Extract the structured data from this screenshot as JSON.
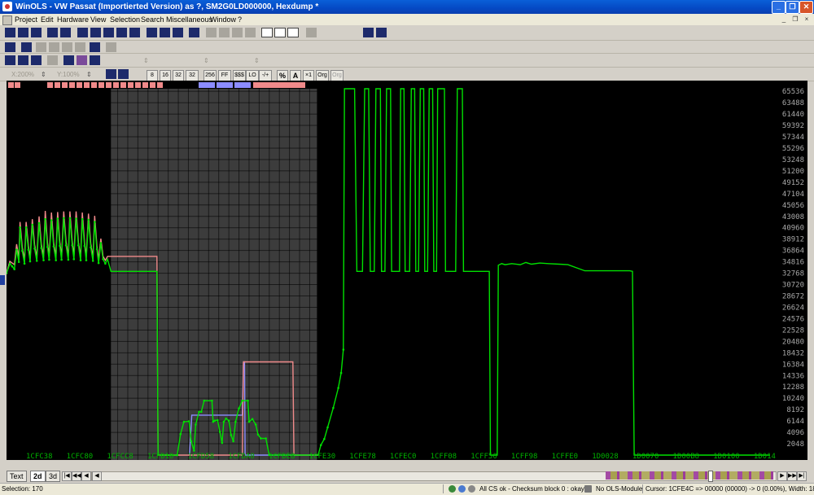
{
  "window": {
    "title": "WinOLS - VW Passat (Importierted Version) as ?, SM2G0LD000000, Hexdump *",
    "controls": [
      "_",
      "❐",
      "✕"
    ]
  },
  "menu": {
    "items": [
      "Project",
      "Edit",
      "Hardware",
      "View",
      "Selection",
      "Search",
      "Miscellaneous",
      "Window",
      "?"
    ],
    "mdi_controls": [
      "_",
      "❐",
      "×"
    ]
  },
  "toolbar3": {
    "zoom_x": "X:200%",
    "zoom_y": "Y:100%",
    "labels": [
      "8",
      "16",
      "32",
      "32 FL",
      "256",
      "FF",
      "$$$",
      "LO HI",
      "-/+",
      "%",
      "A",
      "×1",
      "Org",
      "Org"
    ]
  },
  "colors": {
    "chart_bg": "#000000",
    "primary_line": "#00e000",
    "secondary_line": "#f08a8a",
    "tertiary_line": "#8c8cff",
    "selection_bg": "#3c3c3c",
    "grid": "#141414"
  },
  "chart_data": {
    "type": "line",
    "title": "",
    "xlabel": "",
    "ylabel": "",
    "ylim": [
      0,
      66000
    ],
    "y_ticks": [
      0,
      2048,
      4096,
      6144,
      8192,
      10240,
      12288,
      14336,
      16384,
      18432,
      20480,
      22528,
      24576,
      26624,
      28672,
      30720,
      32768,
      34816,
      36864,
      38912,
      40960,
      43008,
      45056,
      47104,
      49152,
      51200,
      53248,
      55296,
      57344,
      59392,
      61440,
      63488,
      65536
    ],
    "x_ticks": [
      "1CFC38",
      "1CFC80",
      "1CFCC8",
      "1CFD10",
      "1CFD58",
      "1CFDA0",
      "1CFDE8",
      "1CFE30",
      "1CFE78",
      "1CFEC0",
      "1CFF08",
      "1CFF50",
      "1CFF98",
      "1CFFE0",
      "1D0028",
      "1D0070",
      "1D00B8",
      "1D0100",
      "1D0148"
    ],
    "x_tick_labels": [
      "1CFC38",
      "1CFC80",
      "1CFCC8",
      "1CFD10",
      "1CFD58",
      "1CFDA0",
      "1CFDE8",
      "1CFE30",
      "1CFE78",
      "1CFEC0",
      "1CFF08",
      "1CFF50",
      "1CFF98",
      "1CFFE0",
      "1D0028",
      "1D0070",
      "1D00B8",
      "1D0100",
      "1D014"
    ],
    "x_tick_offsets": [
      0,
      72,
      144,
      216,
      288,
      360,
      432,
      504,
      576,
      648,
      720,
      792,
      864,
      936,
      1008,
      1080,
      1152,
      1224,
      1296
    ],
    "x_max": 1360,
    "selection_x": [
      186,
      553
    ],
    "series": [
      {
        "role": "primary",
        "points": [
          [
            0,
            32768
          ],
          [
            6,
            34500
          ],
          [
            10,
            34000
          ],
          [
            14,
            33500
          ],
          [
            18,
            37000
          ],
          [
            22,
            34800
          ],
          [
            24,
            41000
          ],
          [
            28,
            36800
          ],
          [
            32,
            34500
          ],
          [
            35,
            41000
          ],
          [
            39,
            37000
          ],
          [
            42,
            34900
          ],
          [
            46,
            41500
          ],
          [
            50,
            37200
          ],
          [
            54,
            35000
          ],
          [
            58,
            41800
          ],
          [
            62,
            37300
          ],
          [
            66,
            35100
          ],
          [
            69,
            42500
          ],
          [
            73,
            37500
          ],
          [
            76,
            35200
          ],
          [
            80,
            42300
          ],
          [
            84,
            37600
          ],
          [
            88,
            35100
          ],
          [
            91,
            42600
          ],
          [
            95,
            37700
          ],
          [
            98,
            35200
          ],
          [
            102,
            42700
          ],
          [
            106,
            37800
          ],
          [
            110,
            35200
          ],
          [
            113,
            42700
          ],
          [
            117,
            37800
          ],
          [
            120,
            35300
          ],
          [
            124,
            42600
          ],
          [
            128,
            37800
          ],
          [
            132,
            35100
          ],
          [
            135,
            42500
          ],
          [
            139,
            37700
          ],
          [
            142,
            35100
          ],
          [
            146,
            42400
          ],
          [
            150,
            37400
          ],
          [
            154,
            35000
          ],
          [
            157,
            42000
          ],
          [
            161,
            37100
          ],
          [
            164,
            34600
          ],
          [
            168,
            38200
          ],
          [
            172,
            35300
          ],
          [
            176,
            34500
          ],
          [
            180,
            35300
          ],
          [
            186,
            33100
          ],
          [
            266,
            33100
          ],
          [
            268,
            33100
          ],
          [
            270,
            0
          ],
          [
            304,
            0
          ],
          [
            310,
            3800
          ],
          [
            316,
            6000
          ],
          [
            325,
            6100
          ],
          [
            329,
            2500
          ],
          [
            334,
            800
          ],
          [
            337,
            5500
          ],
          [
            343,
            7800
          ],
          [
            347,
            7800
          ],
          [
            352,
            9800
          ],
          [
            366,
            9800
          ],
          [
            368,
            6000
          ],
          [
            371,
            6200
          ],
          [
            376,
            6300
          ],
          [
            380,
            4200
          ],
          [
            384,
            2200
          ],
          [
            387,
            6000
          ],
          [
            391,
            6600
          ],
          [
            396,
            6200
          ],
          [
            400,
            3600
          ],
          [
            404,
            2500
          ],
          [
            408,
            6000
          ],
          [
            414,
            8400
          ],
          [
            420,
            9800
          ],
          [
            430,
            9800
          ],
          [
            432,
            6000
          ],
          [
            438,
            6500
          ],
          [
            444,
            5500
          ],
          [
            448,
            3700
          ],
          [
            453,
            3000
          ],
          [
            462,
            3000
          ],
          [
            468,
            0
          ],
          [
            555,
            0
          ],
          [
            560,
            1800
          ],
          [
            566,
            2900
          ],
          [
            572,
            5000
          ],
          [
            582,
            8500
          ],
          [
            591,
            12100
          ],
          [
            596,
            14800
          ],
          [
            600,
            19000
          ],
          [
            602,
            66000
          ],
          [
            620,
            66000
          ],
          [
            624,
            33100
          ],
          [
            630,
            33100
          ],
          [
            634,
            33100
          ],
          [
            638,
            66000
          ],
          [
            645,
            66000
          ],
          [
            648,
            33100
          ],
          [
            655,
            33100
          ],
          [
            658,
            66000
          ],
          [
            666,
            66000
          ],
          [
            668,
            33100
          ],
          [
            674,
            33100
          ],
          [
            677,
            66000
          ],
          [
            684,
            66000
          ],
          [
            686,
            33100
          ],
          [
            700,
            33100
          ],
          [
            702,
            66000
          ],
          [
            708,
            66000
          ],
          [
            710,
            33100
          ],
          [
            718,
            33100
          ],
          [
            721,
            66000
          ],
          [
            727,
            66000
          ],
          [
            729,
            33100
          ],
          [
            734,
            33100
          ],
          [
            737,
            66000
          ],
          [
            743,
            66000
          ],
          [
            745,
            33100
          ],
          [
            750,
            33100
          ],
          [
            753,
            66000
          ],
          [
            759,
            66000
          ],
          [
            761,
            33100
          ],
          [
            766,
            33100
          ],
          [
            768,
            66000
          ],
          [
            780,
            66000
          ],
          [
            782,
            33100
          ],
          [
            800,
            33100
          ],
          [
            803,
            66000
          ],
          [
            812,
            66000
          ],
          [
            814,
            33100
          ],
          [
            860,
            33100
          ],
          [
            862,
            0
          ],
          [
            874,
            0
          ],
          [
            876,
            34200
          ],
          [
            882,
            34500
          ],
          [
            888,
            34300
          ],
          [
            900,
            34500
          ],
          [
            915,
            34300
          ],
          [
            925,
            34700
          ],
          [
            935,
            34400
          ],
          [
            950,
            34600
          ],
          [
            965,
            34500
          ],
          [
            985,
            34400
          ],
          [
            1000,
            34300
          ],
          [
            1030,
            33200
          ],
          [
            1110,
            33200
          ],
          [
            1115,
            33100
          ],
          [
            1118,
            0
          ],
          [
            1360,
            0
          ]
        ]
      },
      {
        "role": "secondary",
        "points": [
          [
            0,
            32768
          ],
          [
            6,
            34900
          ],
          [
            10,
            34600
          ],
          [
            14,
            34300
          ],
          [
            18,
            38000
          ],
          [
            22,
            35500
          ],
          [
            24,
            42000
          ],
          [
            28,
            37500
          ],
          [
            32,
            35200
          ],
          [
            35,
            42000
          ],
          [
            39,
            37700
          ],
          [
            42,
            35500
          ],
          [
            46,
            42500
          ],
          [
            50,
            37900
          ],
          [
            54,
            35600
          ],
          [
            58,
            43000
          ],
          [
            62,
            38000
          ],
          [
            66,
            35800
          ],
          [
            69,
            44000
          ],
          [
            73,
            38300
          ],
          [
            76,
            35900
          ],
          [
            80,
            43700
          ],
          [
            84,
            38300
          ],
          [
            88,
            35800
          ],
          [
            91,
            43800
          ],
          [
            95,
            38400
          ],
          [
            98,
            35800
          ],
          [
            102,
            43900
          ],
          [
            106,
            38500
          ],
          [
            110,
            35800
          ],
          [
            113,
            43900
          ],
          [
            117,
            38500
          ],
          [
            120,
            35900
          ],
          [
            124,
            43900
          ],
          [
            128,
            38400
          ],
          [
            132,
            35700
          ],
          [
            135,
            43700
          ],
          [
            139,
            38300
          ],
          [
            142,
            35700
          ],
          [
            146,
            43500
          ],
          [
            150,
            38100
          ],
          [
            154,
            35600
          ],
          [
            157,
            43100
          ],
          [
            161,
            37800
          ],
          [
            164,
            35200
          ],
          [
            168,
            39000
          ],
          [
            172,
            35800
          ],
          [
            176,
            35100
          ],
          [
            180,
            35800
          ],
          [
            186,
            35800
          ],
          [
            266,
            35800
          ],
          [
            268,
            35800
          ],
          [
            270,
            0
          ],
          [
            326,
            0
          ],
          [
            330,
            0
          ],
          [
            420,
            0
          ],
          [
            422,
            16800
          ],
          [
            510,
            16800
          ],
          [
            512,
            0
          ],
          [
            555,
            0
          ]
        ]
      },
      {
        "role": "tertiary",
        "points": [
          [
            326,
            0
          ],
          [
            330,
            7200
          ],
          [
            420,
            7200
          ],
          [
            422,
            16800
          ],
          [
            424,
            16800
          ],
          [
            425,
            0
          ],
          [
            555,
            0
          ]
        ]
      }
    ]
  },
  "bottom_tabs": [
    "Text",
    "2d",
    "3d"
  ],
  "bottom_nav": [
    "|◀",
    "◀◀",
    "◀",
    "◀"
  ],
  "bottom_nav_right": [
    "▶",
    "▶▶",
    "▶|"
  ],
  "status": {
    "selection": "Selection: 170",
    "checksum": "All CS ok - Checksum block 0 : okay",
    "module": "No OLS-Module",
    "cursor": "Cursor: 1CFE4C => 00000 (00000) -> 0 (0.00%), Width: 18"
  }
}
